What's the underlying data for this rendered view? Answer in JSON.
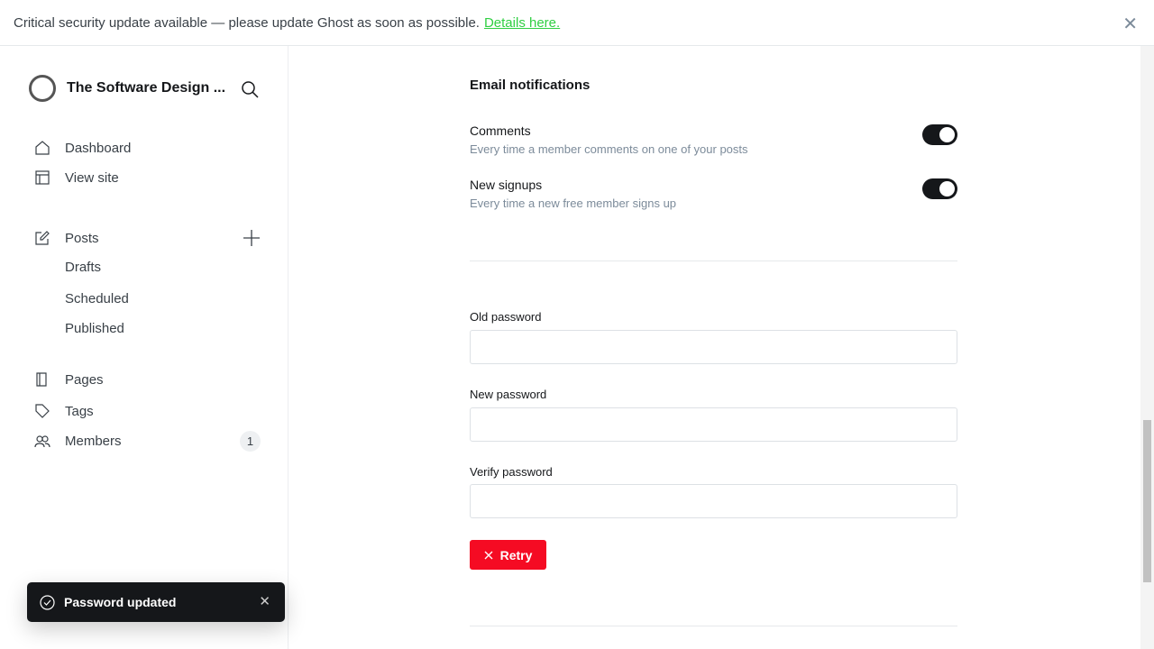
{
  "banner": {
    "text": "Critical security update available — please update Ghost as soon as possible.",
    "link": "Details here.",
    "close": "✕"
  },
  "sidebar": {
    "site_name": "The Software Design ...",
    "items": [
      {
        "label": "Dashboard"
      },
      {
        "label": "View site"
      },
      {
        "label": "Posts"
      },
      {
        "label": "Drafts"
      },
      {
        "label": "Scheduled"
      },
      {
        "label": "Published"
      },
      {
        "label": "Pages"
      },
      {
        "label": "Tags"
      },
      {
        "label": "Members",
        "count": "1"
      }
    ]
  },
  "email": {
    "heading": "Email notifications",
    "comments": {
      "title": "Comments",
      "desc": "Every time a member comments on one of your posts",
      "enabled": true
    },
    "signups": {
      "title": "New signups",
      "desc": "Every time a new free member signs up",
      "enabled": true
    }
  },
  "password": {
    "old_label": "Old password",
    "new_label": "New password",
    "verify_label": "Verify password",
    "old_value": "",
    "new_value": "",
    "verify_value": "",
    "retry": "Retry"
  },
  "toast": {
    "message": "Password updated",
    "close": "✕"
  },
  "colors": {
    "accent": "#30cf43",
    "danger": "#f50b23",
    "dark": "#15171a"
  }
}
